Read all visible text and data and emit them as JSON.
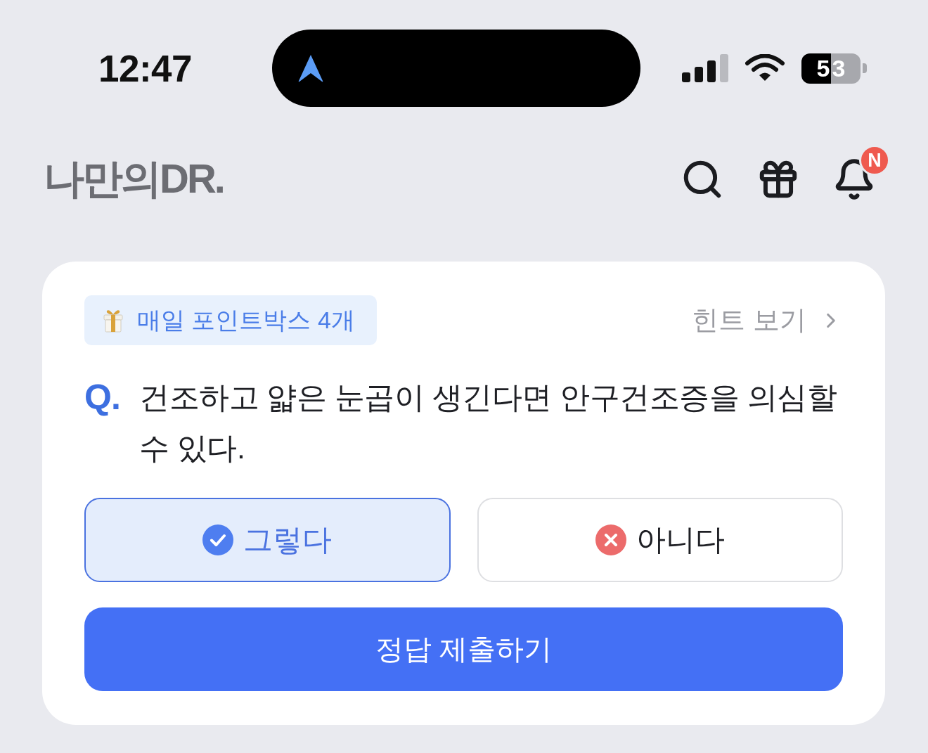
{
  "status_bar": {
    "time": "12:47",
    "battery": "53"
  },
  "header": {
    "logo": "나만의DR.",
    "notification_badge": "N"
  },
  "card": {
    "daily_chip": "매일 포인트박스 4개",
    "hint_link": "힌트 보기",
    "question": {
      "prefix": "Q.",
      "text": "건조하고 얇은 눈곱이 생긴다면 안구건조증을 의심할 수 있다."
    },
    "options": [
      {
        "kind": "yes",
        "label": "그렇다",
        "selected": true
      },
      {
        "kind": "no",
        "label": "아니다",
        "selected": false
      }
    ],
    "submit": "정답 제출하기"
  }
}
